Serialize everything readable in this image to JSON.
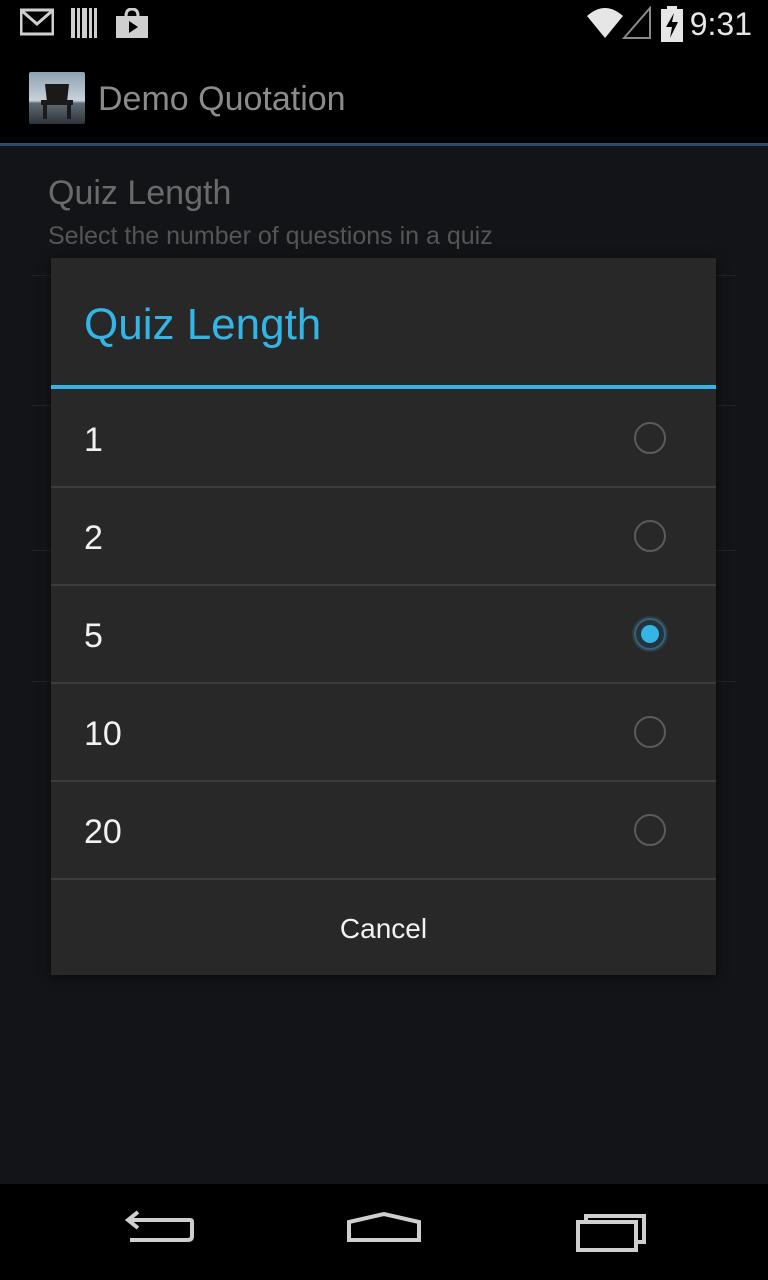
{
  "status_bar": {
    "time": "9:31",
    "icons": [
      "gmail-icon",
      "barcode-icon",
      "play-store-icon",
      "wifi-icon",
      "signal-icon",
      "battery-charging-icon"
    ]
  },
  "action_bar": {
    "title": "Demo Quotation",
    "icon": "app-chair-icon"
  },
  "background_settings": {
    "item_title": "Quiz Length",
    "item_summary": "Select the number of questions in a quiz"
  },
  "dialog": {
    "title": "Quiz Length",
    "options": [
      {
        "label": "1",
        "checked": false
      },
      {
        "label": "2",
        "checked": false
      },
      {
        "label": "5",
        "checked": true
      },
      {
        "label": "10",
        "checked": false
      },
      {
        "label": "20",
        "checked": false
      }
    ],
    "selected_value": "5",
    "cancel_label": "Cancel"
  },
  "nav_bar": {
    "buttons": [
      "back-icon",
      "home-icon",
      "recents-icon"
    ]
  },
  "colors": {
    "accent": "#33b5e5",
    "dialog_background": "#282828",
    "content_background": "#121417"
  }
}
